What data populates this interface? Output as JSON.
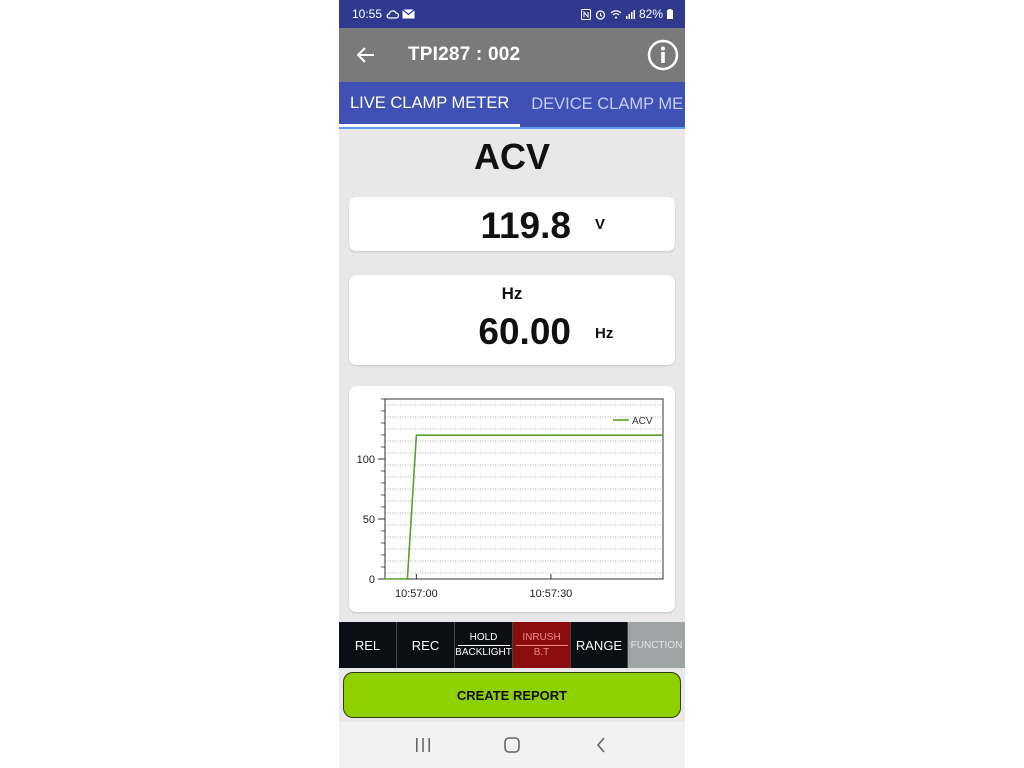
{
  "status_bar": {
    "time": "10:55",
    "battery": "82%",
    "icons": [
      "cloud-icon",
      "mail-icon",
      "nfc-icon",
      "alarm-icon",
      "wifi-icon",
      "signal-icon",
      "battery-icon"
    ]
  },
  "app_bar": {
    "title": "TPI287 : 002",
    "icons": [
      "back-arrow-icon",
      "info-icon"
    ]
  },
  "tabs": [
    {
      "label": "LIVE CLAMP METER",
      "active": true
    },
    {
      "label": "DEVICE CLAMP ME",
      "active": false
    }
  ],
  "mode": "ACV",
  "primary_reading": {
    "value": "119.8",
    "unit": "V"
  },
  "secondary_reading": {
    "label": "Hz",
    "value": "60.00",
    "unit": "Hz"
  },
  "chart_data": {
    "type": "line",
    "x_tick_labels": [
      "10:57:00",
      "10:57:30"
    ],
    "y_tick_labels": [
      "0",
      "50",
      "100"
    ],
    "ylim": [
      0,
      150
    ],
    "grid": true,
    "legend_position": "top-right",
    "series": [
      {
        "name": "ACV",
        "color": "#5aa02c",
        "points": [
          {
            "x": "10:56:53",
            "y": 0
          },
          {
            "x": "10:56:58",
            "y": 0
          },
          {
            "x": "10:57:00",
            "y": 119.8
          },
          {
            "x": "10:57:30",
            "y": 119.8
          },
          {
            "x": "10:57:55",
            "y": 119.8
          }
        ]
      }
    ]
  },
  "function_buttons": [
    {
      "label": "REL"
    },
    {
      "label": "REC"
    },
    {
      "top": "HOLD",
      "bottom": "BACKLIGHT"
    },
    {
      "top": "INRUSH",
      "bottom": "B.T"
    },
    {
      "label": "RANGE"
    },
    {
      "label": "FUNCTION"
    }
  ],
  "report_button": "CREATE REPORT",
  "colors": {
    "status_bar": "#2f3a8f",
    "app_bar": "#7a7a7a",
    "tabs": "#3f51b5",
    "accent_green": "#8fd000",
    "inrush": "#8b0d0d"
  }
}
